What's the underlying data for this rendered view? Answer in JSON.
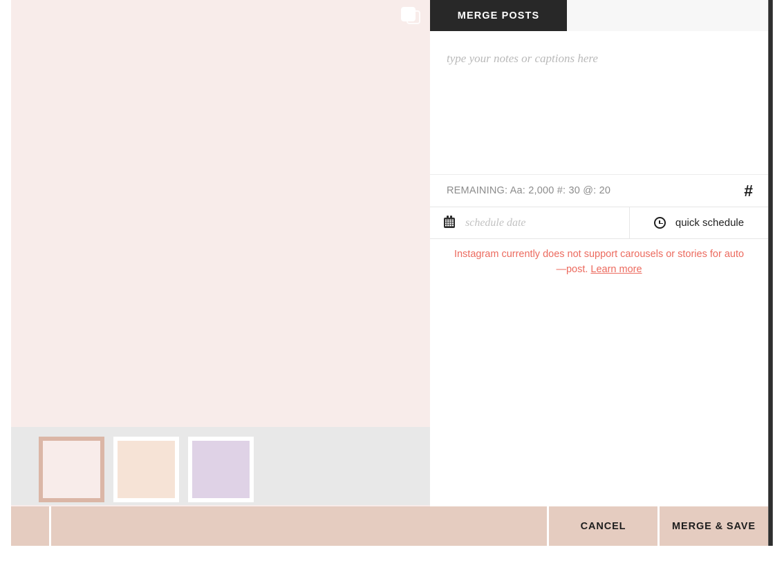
{
  "tabs": [
    {
      "label": "MERGE POSTS",
      "active": true
    }
  ],
  "left_panel": {
    "duplicate_icon_name": "duplicate-icon",
    "preview_color": "#f8ecea",
    "strip_background": "#e8e8e8",
    "thumbnails": [
      {
        "color": "#f8ecea",
        "selected": true,
        "border_color": "#dbb6a6"
      },
      {
        "color": "#f6e3d6",
        "selected": false,
        "border_color": "#ffffff"
      },
      {
        "color": "#dfd2e6",
        "selected": false,
        "border_color": "#ffffff"
      }
    ]
  },
  "notes": {
    "value": "",
    "placeholder": "type your notes or captions here"
  },
  "remaining": {
    "text": "REMAINING: Aa: 2,000  #: 30  @: 20",
    "characters_label": "Aa",
    "characters_left": "2,000",
    "hashtags_label": "#",
    "hashtags_left": "30",
    "mentions_label": "@",
    "mentions_left": "20",
    "hashtag_button": "#"
  },
  "schedule": {
    "date_value": "",
    "date_placeholder": "schedule date",
    "quick_schedule_label": "quick schedule",
    "calendar_icon": "calendar-icon",
    "clock_icon": "clock-icon"
  },
  "warning": {
    "message": "Instagram currently does not support carousels or stories for auto—post.",
    "link_label": "Learn more",
    "color": "#ec6a5e"
  },
  "footer": {
    "cancel_label": "CANCEL",
    "merge_save_label": "MERGE & SAVE",
    "background": "#e5ccc0"
  }
}
